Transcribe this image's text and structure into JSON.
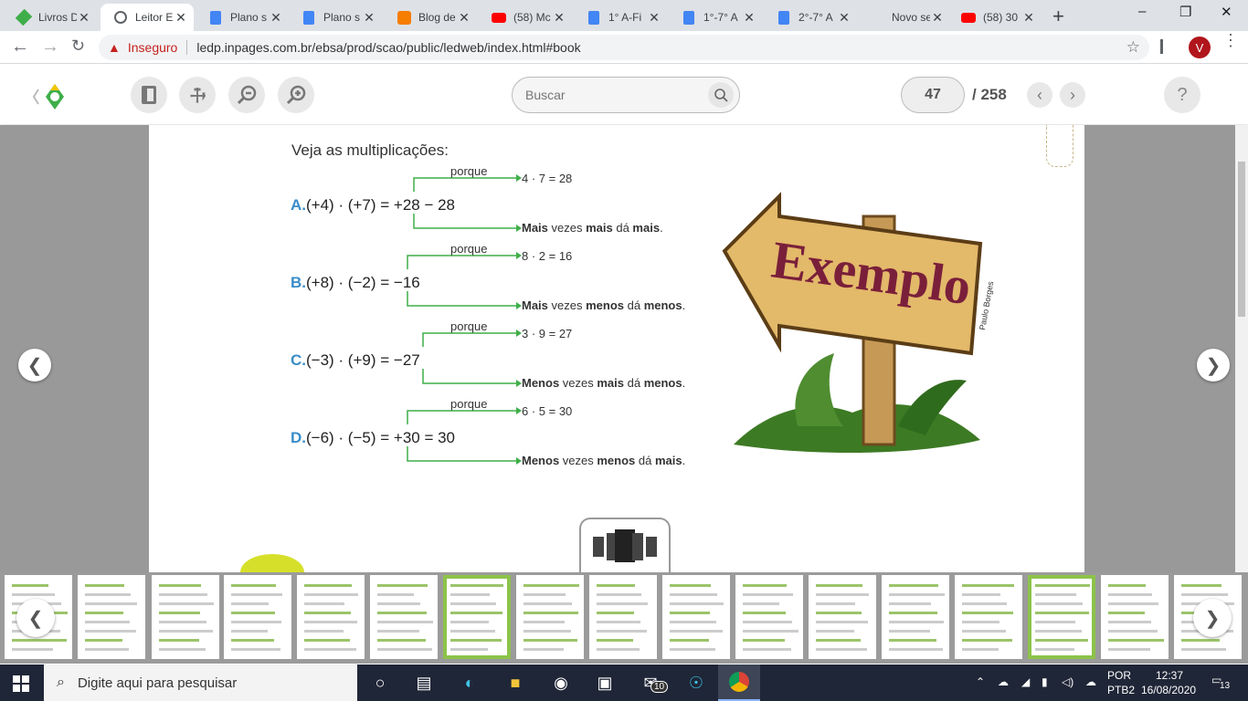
{
  "browser": {
    "tabs": [
      {
        "title": "Livros D",
        "icon": "edu-logo-icon",
        "active": false
      },
      {
        "title": "Leitor E",
        "icon": "globe-icon",
        "active": true
      },
      {
        "title": "Plano s",
        "icon": "docs-icon",
        "active": false
      },
      {
        "title": "Plano s",
        "icon": "docs-icon",
        "active": false
      },
      {
        "title": "Blog de",
        "icon": "blogger-icon",
        "active": false
      },
      {
        "title": "(58) Mc",
        "icon": "youtube-icon",
        "active": false
      },
      {
        "title": "1° A-Fi",
        "icon": "docs-icon",
        "active": false
      },
      {
        "title": "1°-7° A",
        "icon": "docs-icon",
        "active": false
      },
      {
        "title": "2°-7° A",
        "icon": "docs-icon",
        "active": false
      },
      {
        "title": "Novo separ",
        "icon": "none",
        "active": false
      },
      {
        "title": "(58) 30",
        "icon": "youtube-icon",
        "active": false
      }
    ],
    "security_label": "Inseguro",
    "url": "ledp.inpages.com.br/ebsa/prod/scao/public/ledweb/index.html#book",
    "profile_initial": "V"
  },
  "reader": {
    "search_placeholder": "Buscar",
    "current_page": "47",
    "total_pages": "/ 258",
    "help": "?"
  },
  "content": {
    "heading": "Veja as multiplicações:",
    "examples": [
      {
        "letter": "A.",
        "expr": "(+4) · (+7) = +28 − 28",
        "porque": "porque",
        "calc": "4 · 7 = 28",
        "rule": [
          {
            "t": "Mais",
            "b": true
          },
          {
            "t": " vezes ",
            "b": false
          },
          {
            "t": "mais",
            "b": true
          },
          {
            "t": " dá ",
            "b": false
          },
          {
            "t": "mais",
            "b": true
          },
          {
            "t": ".",
            "b": false
          }
        ]
      },
      {
        "letter": "B.",
        "expr": "(+8) · (−2) = −16",
        "porque": "porque",
        "calc": "8 · 2 = 16",
        "rule": [
          {
            "t": "Mais",
            "b": true
          },
          {
            "t": " vezes ",
            "b": false
          },
          {
            "t": "menos",
            "b": true
          },
          {
            "t": " dá ",
            "b": false
          },
          {
            "t": "menos",
            "b": true
          },
          {
            "t": ".",
            "b": false
          }
        ]
      },
      {
        "letter": "C.",
        "expr": "(−3) · (+9) = −27",
        "porque": "porque",
        "calc": "3 · 9 = 27",
        "rule": [
          {
            "t": "Menos",
            "b": true
          },
          {
            "t": " vezes ",
            "b": false
          },
          {
            "t": "mais",
            "b": true
          },
          {
            "t": " dá ",
            "b": false
          },
          {
            "t": "menos",
            "b": true
          },
          {
            "t": ".",
            "b": false
          }
        ]
      },
      {
        "letter": "D.",
        "expr": "(−6) · (−5) = +30 = 30",
        "porque": "porque",
        "calc": "6 · 5 = 30",
        "rule": [
          {
            "t": "Menos",
            "b": true
          },
          {
            "t": " vezes ",
            "b": false
          },
          {
            "t": "menos",
            "b": true
          },
          {
            "t": " dá ",
            "b": false
          },
          {
            "t": "mais",
            "b": true
          },
          {
            "t": ".",
            "b": false
          }
        ]
      }
    ],
    "sign_text": "Exemplo",
    "credit": "Paulo Borges"
  },
  "taskbar": {
    "search_placeholder": "Digite aqui para pesquisar",
    "mail_badge": "10",
    "lang": "POR",
    "layout": "PTB2",
    "time": "12:37",
    "date": "16/08/2020",
    "notif_count": "13"
  },
  "colors": {
    "green": "#3fae49",
    "blue": "#3a8dc8",
    "accent": "#8cc34a"
  }
}
